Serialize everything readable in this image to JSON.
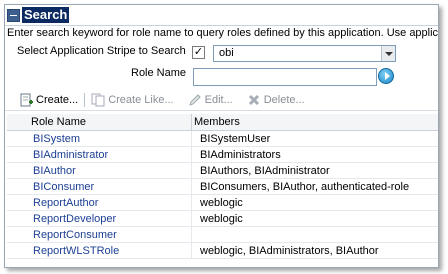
{
  "section": {
    "title": "Search"
  },
  "instruction": "Enter search keyword for role name to query roles defined by this application. Use applic",
  "form": {
    "stripe_label": "Select Application Stripe to Search",
    "stripe_checked": true,
    "stripe_value": "obi",
    "role_label": "Role Name",
    "role_value": ""
  },
  "toolbar": {
    "create": "Create...",
    "create_like": "Create Like...",
    "edit": "Edit...",
    "delete": "Delete..."
  },
  "table": {
    "columns": [
      "Role Name",
      "Members"
    ],
    "rows": [
      {
        "name": "BISystem",
        "members": "BISystemUser"
      },
      {
        "name": "BIAdministrator",
        "members": "BIAdministrators"
      },
      {
        "name": "BIAuthor",
        "members": "BIAuthors, BIAdministrator"
      },
      {
        "name": "BIConsumer",
        "members": "BIConsumers, BIAuthor, authenticated-role"
      },
      {
        "name": "ReportAuthor",
        "members": "weblogic"
      },
      {
        "name": "ReportDeveloper",
        "members": "weblogic"
      },
      {
        "name": "ReportConsumer",
        "members": ""
      },
      {
        "name": "ReportWLSTRole",
        "members": "weblogic, BIAdministrators, BIAuthor"
      }
    ]
  }
}
